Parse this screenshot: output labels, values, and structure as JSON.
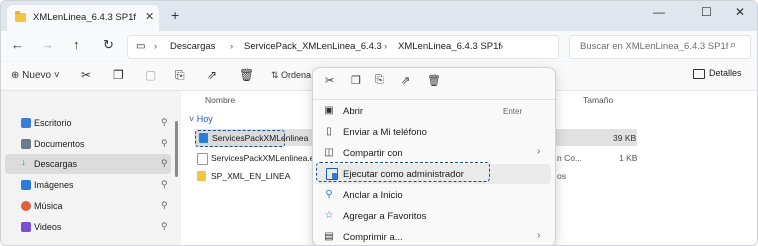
{
  "window": {
    "tab_title": "XMLenLinea_6.4.3 SP1f",
    "close_tab": "✕",
    "new_tab": "+",
    "minimize": "—",
    "maximize": "☐",
    "close": "✕"
  },
  "address": {
    "crumbs": [
      "Descargas",
      "ServicePack_XMLenLinea_6.4.3",
      "XMLenLinea_6.4.3 SP1f"
    ],
    "search_placeholder": "Buscar en XMLenLinea_6.4.3 SP1f"
  },
  "toolbar": {
    "new_label": "Nuevo",
    "sort_label": "Ordena",
    "details_label": "Detalles"
  },
  "sidebar": {
    "items": [
      {
        "label": "Escritorio",
        "icon": "desktop-icon",
        "color": "#3a7bd5"
      },
      {
        "label": "Documentos",
        "icon": "documents-icon",
        "color": "#6b7b8c"
      },
      {
        "label": "Descargas",
        "icon": "downloads-icon",
        "color": "#2a9d6a"
      },
      {
        "label": "Imágenes",
        "icon": "pictures-icon",
        "color": "#2b7bd9"
      },
      {
        "label": "Música",
        "icon": "music-icon",
        "color": "#e0603a"
      },
      {
        "label": "Videos",
        "icon": "videos-icon",
        "color": "#7b4ed1"
      }
    ]
  },
  "content": {
    "col_name": "Nombre",
    "col_size": "Tamaño",
    "group": "Hoy",
    "files": [
      {
        "name": "ServicesPackXMLenlinea",
        "size": "39 KB",
        "tail": ""
      },
      {
        "name": "ServicesPackXMLenlinea.exe",
        "size": "1 KB",
        "tail": "n Co..."
      },
      {
        "name": "SP_XML_EN_LINEA",
        "size": "",
        "tail": "os"
      }
    ]
  },
  "context_menu": {
    "items": [
      {
        "label": "Abrir",
        "accel": "Enter",
        "icon": "open-icon"
      },
      {
        "label": "Enviar a Mi teléfono",
        "accel": "",
        "icon": "phone-icon"
      },
      {
        "label": "Compartir con",
        "accel": "",
        "icon": "share-icon",
        "submenu": true
      },
      {
        "label": "Ejecutar como administrador",
        "accel": "",
        "icon": "admin-shield-icon"
      },
      {
        "label": "Anclar a Inicio",
        "accel": "",
        "icon": "pin-icon"
      },
      {
        "label": "Agregar a Favoritos",
        "accel": "",
        "icon": "star-icon"
      },
      {
        "label": "Comprimir a...",
        "accel": "",
        "icon": "zip-icon",
        "submenu": true
      }
    ]
  }
}
